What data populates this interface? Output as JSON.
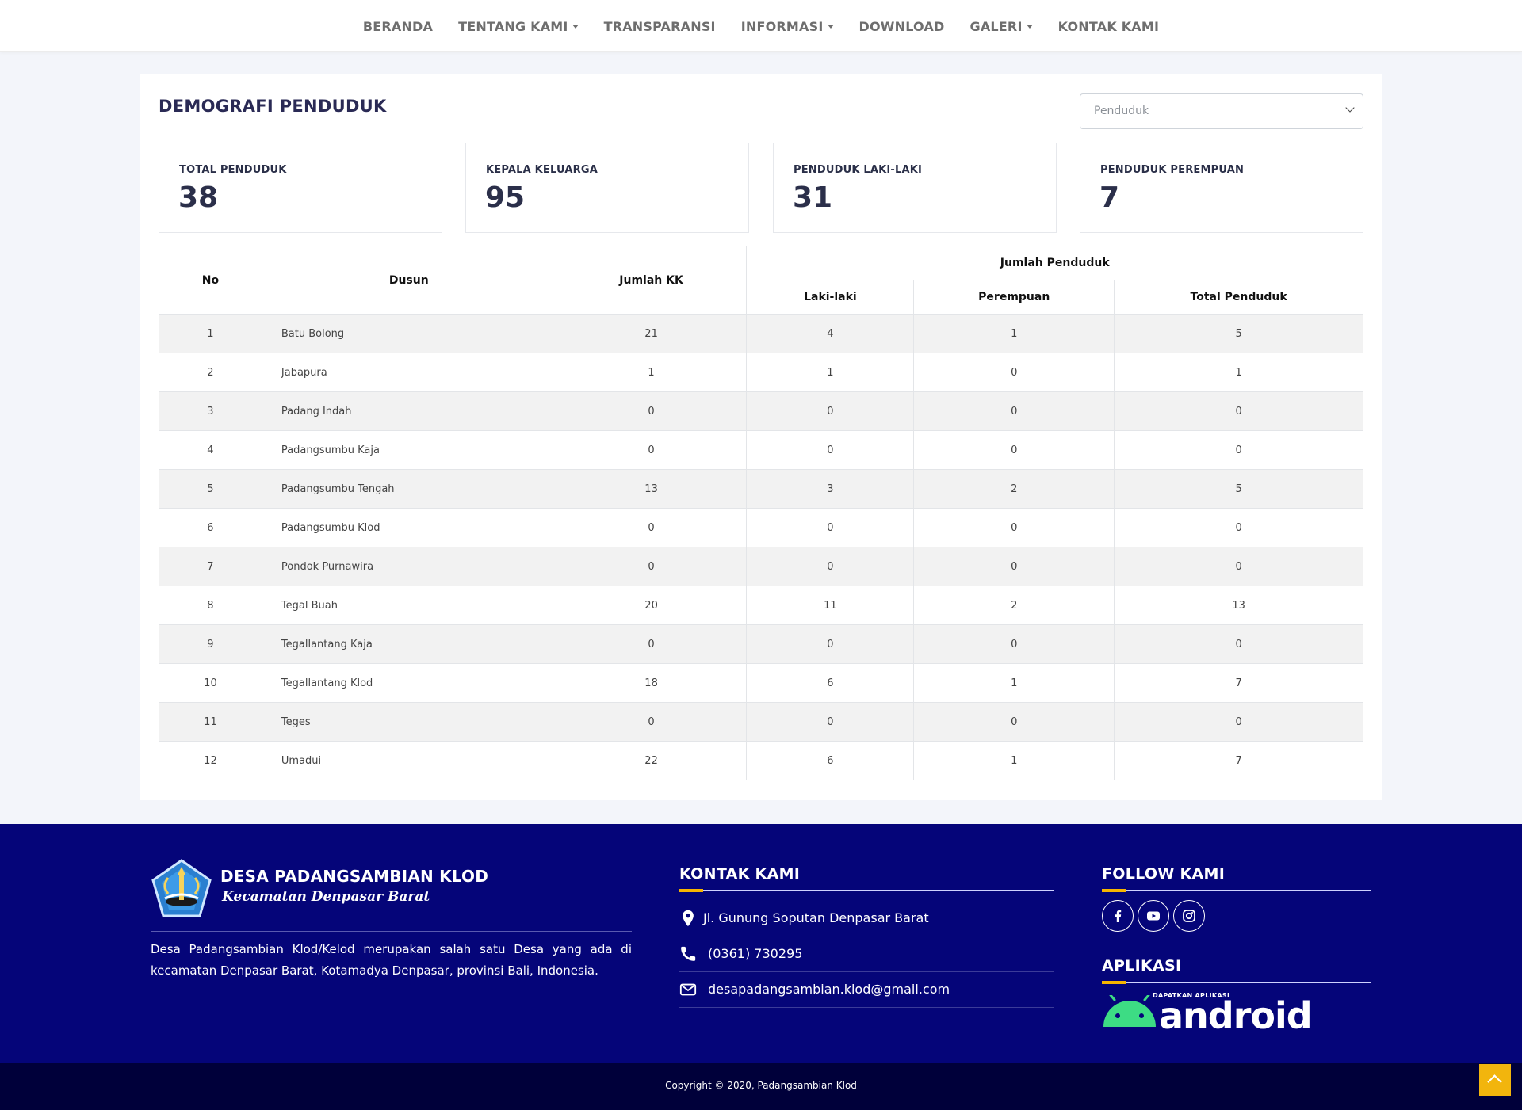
{
  "nav": {
    "items": [
      {
        "label": "BERANDA",
        "dropdown": false
      },
      {
        "label": "TENTANG KAMI",
        "dropdown": true
      },
      {
        "label": "TRANSPARANSI",
        "dropdown": false
      },
      {
        "label": "INFORMASI",
        "dropdown": true
      },
      {
        "label": "DOWNLOAD",
        "dropdown": false
      },
      {
        "label": "GALERI",
        "dropdown": true
      },
      {
        "label": "KONTAK KAMI",
        "dropdown": false
      }
    ]
  },
  "main": {
    "title": "DEMOGRAFI PENDUDUK",
    "select": {
      "value": "Penduduk"
    },
    "stats": [
      {
        "label": "TOTAL PENDUDUK",
        "value": "38"
      },
      {
        "label": "KEPALA KELUARGA",
        "value": "95"
      },
      {
        "label": "PENDUDUK LAKI-LAKI",
        "value": "31"
      },
      {
        "label": "PENDUDUK PEREMPUAN",
        "value": "7"
      }
    ],
    "table": {
      "headers": {
        "no": "No",
        "dusun": "Dusun",
        "jumlah_kk": "Jumlah KK",
        "jumlah_penduduk": "Jumlah Penduduk",
        "laki": "Laki-laki",
        "perempuan": "Perempuan",
        "total": "Total Penduduk"
      },
      "rows": [
        {
          "no": "1",
          "dusun": "Batu Bolong",
          "kk": "21",
          "laki": "4",
          "perempuan": "1",
          "total": "5"
        },
        {
          "no": "2",
          "dusun": "Jabapura",
          "kk": "1",
          "laki": "1",
          "perempuan": "0",
          "total": "1"
        },
        {
          "no": "3",
          "dusun": "Padang Indah",
          "kk": "0",
          "laki": "0",
          "perempuan": "0",
          "total": "0"
        },
        {
          "no": "4",
          "dusun": "Padangsumbu Kaja",
          "kk": "0",
          "laki": "0",
          "perempuan": "0",
          "total": "0"
        },
        {
          "no": "5",
          "dusun": "Padangsumbu Tengah",
          "kk": "13",
          "laki": "3",
          "perempuan": "2",
          "total": "5"
        },
        {
          "no": "6",
          "dusun": "Padangsumbu Klod",
          "kk": "0",
          "laki": "0",
          "perempuan": "0",
          "total": "0"
        },
        {
          "no": "7",
          "dusun": "Pondok Purnawira",
          "kk": "0",
          "laki": "0",
          "perempuan": "0",
          "total": "0"
        },
        {
          "no": "8",
          "dusun": "Tegal Buah",
          "kk": "20",
          "laki": "11",
          "perempuan": "2",
          "total": "13"
        },
        {
          "no": "9",
          "dusun": "Tegallantang Kaja",
          "kk": "0",
          "laki": "0",
          "perempuan": "0",
          "total": "0"
        },
        {
          "no": "10",
          "dusun": "Tegallantang Klod",
          "kk": "18",
          "laki": "6",
          "perempuan": "1",
          "total": "7"
        },
        {
          "no": "11",
          "dusun": "Teges",
          "kk": "0",
          "laki": "0",
          "perempuan": "0",
          "total": "0"
        },
        {
          "no": "12",
          "dusun": "Umadui",
          "kk": "22",
          "laki": "6",
          "perempuan": "1",
          "total": "7"
        }
      ]
    }
  },
  "footer": {
    "logo_title": "DESA PADANGSAMBIAN KLOD",
    "logo_subtitle": "Kecamatan Denpasar Barat",
    "about": "Desa Padangsambian Klod/Kelod merupakan salah satu Desa yang ada di kecamatan Denpasar Barat, Kotamadya Denpasar, provinsi Bali, Indonesia.",
    "contact_heading": "KONTAK KAMI",
    "address": "Jl. Gunung Soputan Denpasar Barat",
    "phone": "(0361) 730295",
    "email": "desapadangsambian.klod@gmail.com",
    "follow_heading": "FOLLOW KAMI",
    "social": [
      "facebook-icon",
      "youtube-icon",
      "instagram-icon"
    ],
    "app_heading": "APLIKASI",
    "android_small": "DAPATKAN APLIKASI",
    "android_word": "android",
    "copyright": "Copyright © 2020, Padangsambian Klod"
  },
  "colors": {
    "footer_bg": "#050579",
    "copyright_bg": "#00003a",
    "accent": "#f7b500",
    "android_green": "#3ddc84"
  }
}
